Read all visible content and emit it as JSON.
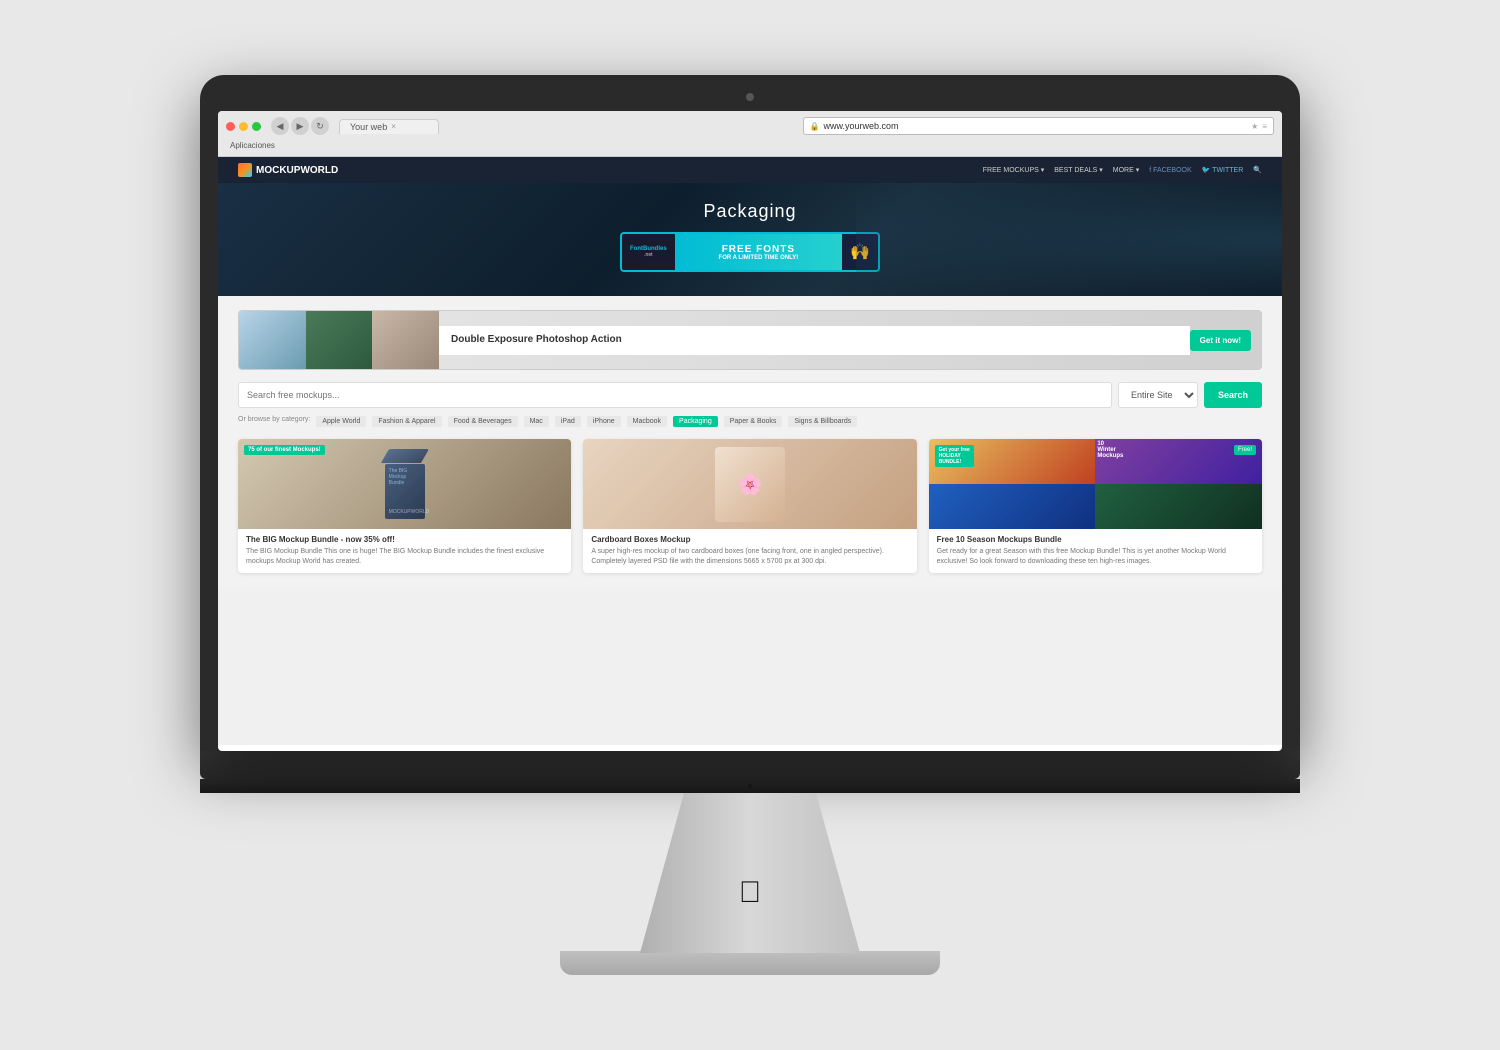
{
  "browser": {
    "tab_title": "Your web",
    "url": "www.yourweb.com",
    "bookmarks_label": "Aplicaciones"
  },
  "nav": {
    "logo_text": "MOCKUPWORLD",
    "links": [
      {
        "label": "FREE MOCKUPS ▾",
        "key": "free-mockups"
      },
      {
        "label": "BEST DEALS ▾",
        "key": "best-deals"
      },
      {
        "label": "MORE ▾",
        "key": "more"
      },
      {
        "label": "f  FACEBOOK",
        "key": "facebook"
      },
      {
        "label": "🐦 TWITTER",
        "key": "twitter"
      },
      {
        "label": "🔍",
        "key": "search"
      }
    ]
  },
  "hero": {
    "title": "Packaging",
    "banner_label": "FREE FONTS",
    "banner_sub": "FOR A LIMITED TIME ONLY!"
  },
  "ad": {
    "title": "Double Exposure Photoshop Action",
    "cta_label": "Get it now!"
  },
  "search": {
    "placeholder": "Search free mockups...",
    "dropdown_value": "Entire Site",
    "button_label": "Search"
  },
  "categories": {
    "label": "Or browse by category:",
    "items": [
      {
        "label": "Apple World",
        "active": false
      },
      {
        "label": "Fashion & Apparel",
        "active": false
      },
      {
        "label": "Food & Beverages",
        "active": false
      },
      {
        "label": "Mac",
        "active": false
      },
      {
        "label": "iPad",
        "active": false
      },
      {
        "label": "iPhone",
        "active": false
      },
      {
        "label": "Macbook",
        "active": false
      },
      {
        "label": "Packaging",
        "active": true
      },
      {
        "label": "Paper & Books",
        "active": false
      },
      {
        "label": "Signs & Billboards",
        "active": false
      }
    ]
  },
  "products": [
    {
      "title": "The BIG Mockup Bundle - now 35% off!",
      "desc": "The BIG Mockup Bundle This one is huge! The BIG Mockup Bundle includes the finest exclusive mockups Mockup World has created.",
      "badge": "75 of our finest Mockups!",
      "type": "bundle"
    },
    {
      "title": "Cardboard Boxes Mockup",
      "desc": "A super high-res mockup of two cardboard boxes (one facing front, one in angled perspective). Completely layered PSD file with the dimensions 5665 x 5700 px at 300 dpi.",
      "badge": "",
      "type": "boxes"
    },
    {
      "title": "Free 10 Season Mockups Bundle",
      "desc": "Get ready for a great Season with this free Mockup Bundle! This is yet another Mockup World exclusive! So look forward to downloading these ten high-res images.",
      "badge": "Get your free HOLIDAY BUNDLE!",
      "badge_free": "Free!",
      "type": "season"
    }
  ]
}
